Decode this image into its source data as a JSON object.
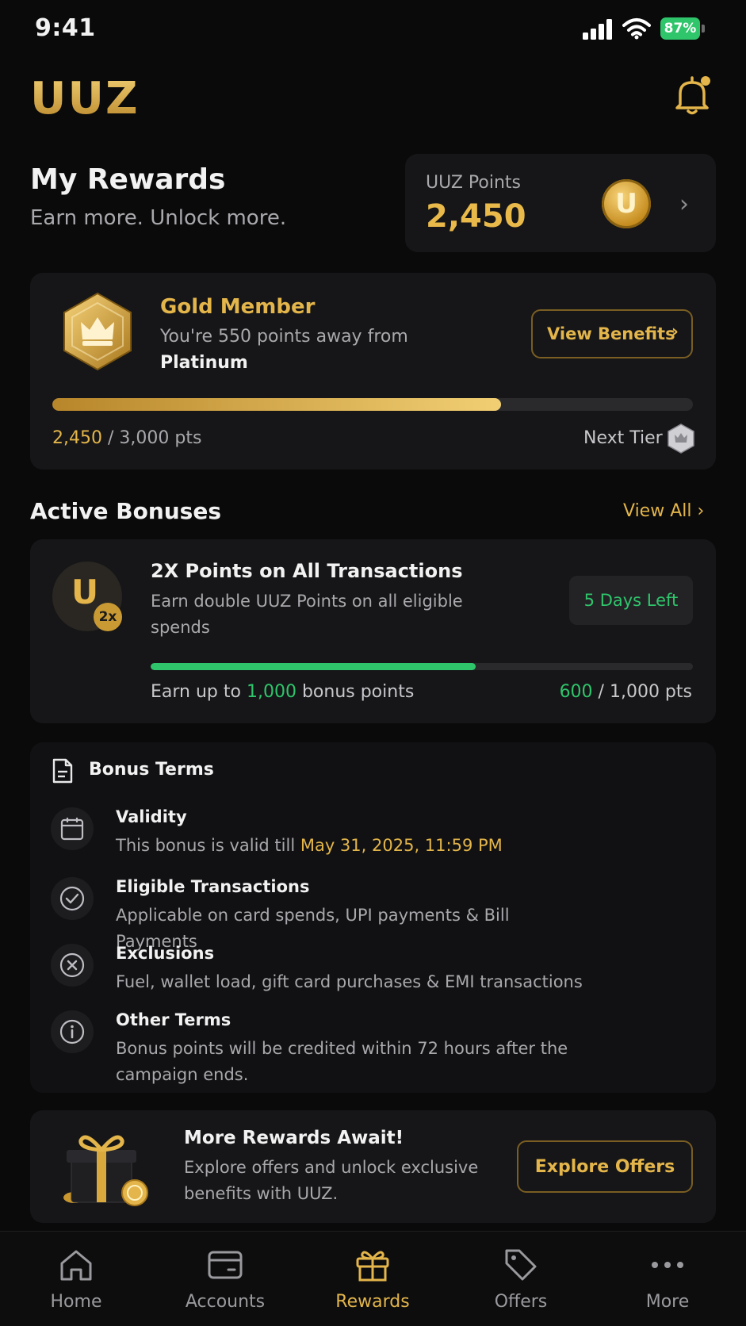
{
  "status_bar": {
    "time": "9:41",
    "battery": "87%"
  },
  "header": {
    "logo": "UUZ"
  },
  "page": {
    "title": "My Rewards",
    "subtitle": "Earn more. Unlock more."
  },
  "points": {
    "label": "UUZ Points",
    "value": "2,450",
    "coin_letter": "U"
  },
  "tier": {
    "name": "Gold Member",
    "desc_prefix": "You're 550 points away from",
    "next_tier_name": "Platinum",
    "button": "View Benefits",
    "current": "2,450",
    "target_text": " / 3,000 pts",
    "progress_fraction": 0.7,
    "next_label": "Next Tier"
  },
  "active_bonuses": {
    "title": "Active Bonuses",
    "view_all": "View All",
    "bonus": {
      "icon_letter": "U",
      "icon_badge": "2x",
      "title": "2X Points on All Transactions",
      "desc": "Earn double UUZ Points on all eligible spends",
      "days_left": "5 Days Left",
      "progress_fraction": 0.6,
      "earn_prefix": "Earn up to ",
      "earn_amount": "1,000",
      "earn_suffix": " bonus points",
      "current": "600",
      "target_text": " / 1,000 pts"
    }
  },
  "terms": {
    "title": "Bonus Terms",
    "items": [
      {
        "title": "Validity",
        "desc_prefix": "This bonus is valid till ",
        "desc_highlight": "May 31, 2025, 11:59 PM",
        "icon": "calendar-icon"
      },
      {
        "title": "Eligible Transactions",
        "desc": "Applicable on card spends, UPI payments & Bill Payments",
        "icon": "check-circle-icon"
      },
      {
        "title": "Exclusions",
        "desc": "Fuel, wallet load, gift card purchases & EMI transactions",
        "icon": "x-circle-icon"
      },
      {
        "title": "Other Terms",
        "desc": "Bonus points will be credited within 72 hours after the campaign ends.",
        "icon": "info-icon"
      }
    ]
  },
  "promo": {
    "title": "More Rewards Await!",
    "desc": "Explore offers and unlock exclusive benefits with UUZ.",
    "button": "Explore Offers"
  },
  "nav": {
    "items": [
      {
        "label": "Home",
        "icon": "home-icon"
      },
      {
        "label": "Accounts",
        "icon": "card-icon"
      },
      {
        "label": "Rewards",
        "icon": "gift-icon"
      },
      {
        "label": "Offers",
        "icon": "tag-icon"
      },
      {
        "label": "More",
        "icon": "more-icon"
      }
    ],
    "active": "Rewards"
  },
  "colors": {
    "accent": "#e3b54a",
    "success": "#2fc56b",
    "background": "#0a0a0b",
    "card": "#161618"
  }
}
